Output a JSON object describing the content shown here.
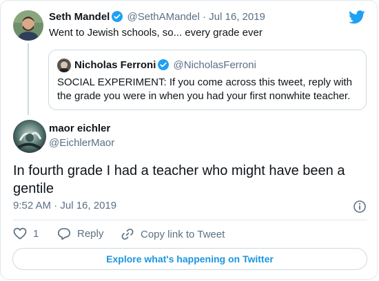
{
  "tweet1": {
    "name": "Seth Mandel",
    "handle": "@SethAMandel",
    "separator": "·",
    "date": "Jul 16, 2019",
    "text": "Went to Jewish schools, so... every grade ever"
  },
  "quote": {
    "name": "Nicholas Ferroni",
    "handle": "@NicholasFerroni",
    "text": "SOCIAL EXPERIMENT: If you come across this tweet, reply with the grade you were in when you had your first nonwhite teacher."
  },
  "main": {
    "name": "maor eichler",
    "handle": "@EichlerMaor",
    "text": "In fourth grade I had a teacher who might have been a gentile",
    "timestamp": "9:52 AM · Jul 16, 2019"
  },
  "actions": {
    "like_count": "1",
    "reply_label": "Reply",
    "copy_label": "Copy link to Tweet"
  },
  "explore_label": "Explore what's happening on Twitter",
  "icons": {
    "brand": "twitter-bird-icon",
    "verified": "verified-badge-icon",
    "info": "info-icon",
    "like": "heart-icon",
    "reply": "reply-bubble-icon",
    "link": "link-icon"
  },
  "colors": {
    "twitter_blue": "#1da1f2",
    "link_blue": "#1b95e0",
    "muted_text": "#5b7083",
    "border": "#cfd9de"
  }
}
